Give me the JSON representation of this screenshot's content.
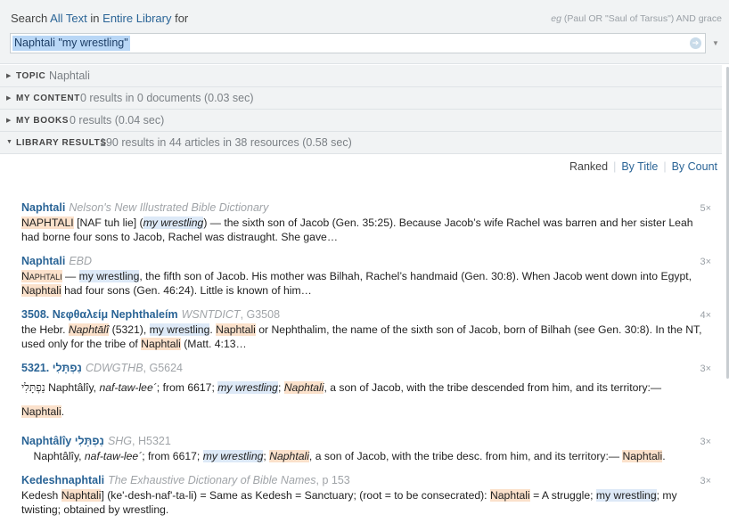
{
  "search": {
    "prefix": "Search",
    "scope_text": "All Text",
    "in_word": "in",
    "scope_library": "Entire Library",
    "for_word": "for",
    "example": {
      "eg": "eg",
      "text": "(Paul OR \"Saul of Tarsus\") AND grace"
    },
    "query": "Naphtali \"my wrestling\""
  },
  "sections": [
    {
      "title": "TOPIC",
      "info": "Naphtali",
      "expanded": false
    },
    {
      "title": "MY CONTENT",
      "info": "0 results in 0 documents (0.03 sec)",
      "expanded": false
    },
    {
      "title": "MY BOOKS",
      "info": "0 results (0.04 sec)",
      "expanded": false
    },
    {
      "title": "LIBRARY RESULTS",
      "info": "190 results in 44 articles in 38 resources (0.58 sec)",
      "expanded": true
    }
  ],
  "sort": {
    "ranked": "Ranked",
    "by_title": "By Title",
    "by_count": "By Count"
  },
  "results": [
    {
      "title": "Naphtali",
      "source": "Nelson's New Illustrated Bible Dictionary",
      "hits": "5×",
      "segments": [
        {
          "t": "NAPHTALI",
          "h": "n"
        },
        {
          "t": " [NAF tuh lie] ("
        },
        {
          "t": "my wrestling",
          "h": "w",
          "i": true
        },
        {
          "t": ") — the sixth son of Jacob (Gen. 35:25). Because Jacob’s wife Rachel was barren and her sister Leah had borne four sons to Jacob, Rachel was distraught. She gave…"
        }
      ]
    },
    {
      "title": "Naphtali",
      "source": "EBD",
      "hits": "3×",
      "segments": [
        {
          "t": "Naphtali",
          "h": "n",
          "sc": true
        },
        {
          "t": " — "
        },
        {
          "t": "my wrestling",
          "h": "w"
        },
        {
          "t": ", the fifth son of Jacob. His mother was Bilhah, Rachel’s handmaid (Gen. 30:8). When Jacob went down into Egypt, "
        },
        {
          "t": "Naphtali",
          "h": "n"
        },
        {
          "t": " had four sons (Gen. 46:24). Little is known of him…"
        }
      ]
    },
    {
      "title": "3508. Νεφθαλείμ Nephthaleím",
      "source": "WSNTDICT",
      "ref": ", G3508",
      "hits": "4×",
      "segments": [
        {
          "t": "the Hebr. "
        },
        {
          "t": "Naphtālî",
          "h": "n",
          "i": true
        },
        {
          "t": " (5321), "
        },
        {
          "t": "my wrestling",
          "h": "w"
        },
        {
          "t": ". "
        },
        {
          "t": "Naphtali",
          "h": "n"
        },
        {
          "t": " or Nephthalim, the name of the sixth son of Jacob, born of Bilhah (see Gen. 30:8). In the NT, used only for the tribe of "
        },
        {
          "t": "Naphtali",
          "h": "n"
        },
        {
          "t": " (Matt. 4:13…"
        }
      ]
    },
    {
      "title": "5321. נַפְתָּלִי",
      "source": "CDWGTHB",
      "ref": ", G5624",
      "hits": "3×",
      "segments": [
        {
          "t": "נַפְתָּלִי",
          "heb": true
        },
        {
          "t": " Naphtâlîy, "
        },
        {
          "t": "naf-taw-lee´",
          "i": true
        },
        {
          "t": "; from 6617; "
        },
        {
          "t": "my wrestling",
          "h": "w",
          "i": true
        },
        {
          "t": "; "
        },
        {
          "t": "Naphtali",
          "h": "n",
          "i": true
        },
        {
          "t": ", a son of Jacob, with the tribe descended from him, and its territory:—"
        },
        {
          "t": "Naphtali",
          "h": "n",
          "br": true
        },
        {
          "t": "."
        }
      ]
    },
    {
      "title": "Naphtâlîy נַפְתָּלִי",
      "source": "SHG",
      "ref": ", H5321",
      "hits": "3×",
      "segments": [
        {
          "t": "    Naphtâlîy, "
        },
        {
          "t": "naf-taw-lee´",
          "i": true
        },
        {
          "t": "; from 6617; "
        },
        {
          "t": "my wrestling",
          "h": "w",
          "i": true
        },
        {
          "t": "; "
        },
        {
          "t": "Naphtali",
          "h": "n",
          "i": true
        },
        {
          "t": ", a son of Jacob, with the tribe desc. from him, and its territory:— "
        },
        {
          "t": "Naphtali",
          "h": "n"
        },
        {
          "t": "."
        }
      ]
    },
    {
      "title": "Kedeshnaphtali",
      "source": "The Exhaustive Dictionary of Bible Names",
      "ref": ", p 153",
      "hits": "3×",
      "segments": [
        {
          "t": "Kedesh "
        },
        {
          "t": "Naphtali",
          "h": "n"
        },
        {
          "t": "] (ke'-desh-naf'-ta-li) = Same as Kedesh = Sanctuary; (root = to be consecrated): "
        },
        {
          "t": "Naphtali",
          "h": "n"
        },
        {
          "t": " = A struggle; "
        },
        {
          "t": "my wrestling",
          "h": "w"
        },
        {
          "t": "; my twisting; obtained by wrestling."
        }
      ]
    }
  ]
}
